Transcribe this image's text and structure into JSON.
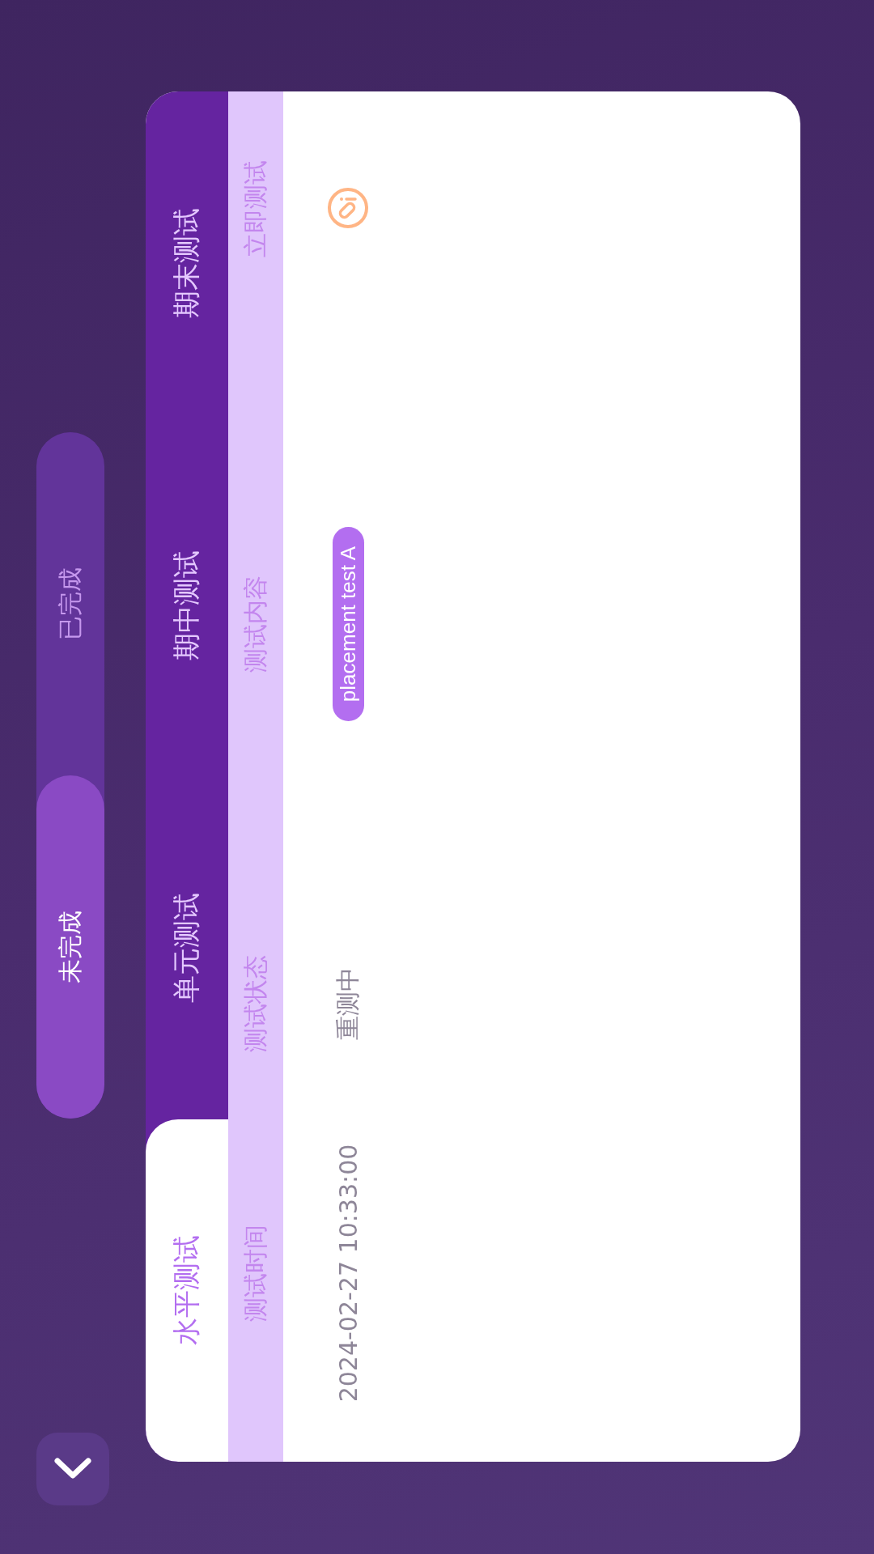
{
  "filter": [
    {
      "label": "未完成",
      "selected": true
    },
    {
      "label": "已完成",
      "selected": false
    }
  ],
  "tabs": [
    {
      "label": "水平测试",
      "selected": true
    },
    {
      "label": "单元测试",
      "selected": false
    },
    {
      "label": "期中测试",
      "selected": false
    },
    {
      "label": "期末测试",
      "selected": false
    }
  ],
  "table": {
    "columns": [
      "测试时间",
      "测试状态",
      "测试内容",
      "立即测试"
    ],
    "rows": [
      {
        "test_time": "2024-02-27 10:33:00",
        "status": "重测中",
        "content": "placement test A"
      }
    ]
  }
}
